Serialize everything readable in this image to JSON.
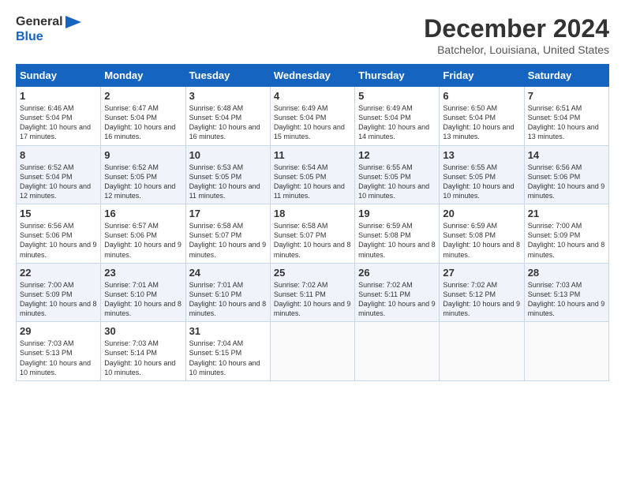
{
  "header": {
    "logo_line1": "General",
    "logo_line2": "Blue",
    "month_title": "December 2024",
    "subtitle": "Batchelor, Louisiana, United States"
  },
  "days_of_week": [
    "Sunday",
    "Monday",
    "Tuesday",
    "Wednesday",
    "Thursday",
    "Friday",
    "Saturday"
  ],
  "weeks": [
    [
      {
        "day": "1",
        "sunrise": "6:46 AM",
        "sunset": "5:04 PM",
        "daylight": "10 hours and 17 minutes."
      },
      {
        "day": "2",
        "sunrise": "6:47 AM",
        "sunset": "5:04 PM",
        "daylight": "10 hours and 16 minutes."
      },
      {
        "day": "3",
        "sunrise": "6:48 AM",
        "sunset": "5:04 PM",
        "daylight": "10 hours and 16 minutes."
      },
      {
        "day": "4",
        "sunrise": "6:49 AM",
        "sunset": "5:04 PM",
        "daylight": "10 hours and 15 minutes."
      },
      {
        "day": "5",
        "sunrise": "6:49 AM",
        "sunset": "5:04 PM",
        "daylight": "10 hours and 14 minutes."
      },
      {
        "day": "6",
        "sunrise": "6:50 AM",
        "sunset": "5:04 PM",
        "daylight": "10 hours and 13 minutes."
      },
      {
        "day": "7",
        "sunrise": "6:51 AM",
        "sunset": "5:04 PM",
        "daylight": "10 hours and 13 minutes."
      }
    ],
    [
      {
        "day": "8",
        "sunrise": "6:52 AM",
        "sunset": "5:04 PM",
        "daylight": "10 hours and 12 minutes."
      },
      {
        "day": "9",
        "sunrise": "6:52 AM",
        "sunset": "5:05 PM",
        "daylight": "10 hours and 12 minutes."
      },
      {
        "day": "10",
        "sunrise": "6:53 AM",
        "sunset": "5:05 PM",
        "daylight": "10 hours and 11 minutes."
      },
      {
        "day": "11",
        "sunrise": "6:54 AM",
        "sunset": "5:05 PM",
        "daylight": "10 hours and 11 minutes."
      },
      {
        "day": "12",
        "sunrise": "6:55 AM",
        "sunset": "5:05 PM",
        "daylight": "10 hours and 10 minutes."
      },
      {
        "day": "13",
        "sunrise": "6:55 AM",
        "sunset": "5:05 PM",
        "daylight": "10 hours and 10 minutes."
      },
      {
        "day": "14",
        "sunrise": "6:56 AM",
        "sunset": "5:06 PM",
        "daylight": "10 hours and 9 minutes."
      }
    ],
    [
      {
        "day": "15",
        "sunrise": "6:56 AM",
        "sunset": "5:06 PM",
        "daylight": "10 hours and 9 minutes."
      },
      {
        "day": "16",
        "sunrise": "6:57 AM",
        "sunset": "5:06 PM",
        "daylight": "10 hours and 9 minutes."
      },
      {
        "day": "17",
        "sunrise": "6:58 AM",
        "sunset": "5:07 PM",
        "daylight": "10 hours and 9 minutes."
      },
      {
        "day": "18",
        "sunrise": "6:58 AM",
        "sunset": "5:07 PM",
        "daylight": "10 hours and 8 minutes."
      },
      {
        "day": "19",
        "sunrise": "6:59 AM",
        "sunset": "5:08 PM",
        "daylight": "10 hours and 8 minutes."
      },
      {
        "day": "20",
        "sunrise": "6:59 AM",
        "sunset": "5:08 PM",
        "daylight": "10 hours and 8 minutes."
      },
      {
        "day": "21",
        "sunrise": "7:00 AM",
        "sunset": "5:09 PM",
        "daylight": "10 hours and 8 minutes."
      }
    ],
    [
      {
        "day": "22",
        "sunrise": "7:00 AM",
        "sunset": "5:09 PM",
        "daylight": "10 hours and 8 minutes."
      },
      {
        "day": "23",
        "sunrise": "7:01 AM",
        "sunset": "5:10 PM",
        "daylight": "10 hours and 8 minutes."
      },
      {
        "day": "24",
        "sunrise": "7:01 AM",
        "sunset": "5:10 PM",
        "daylight": "10 hours and 8 minutes."
      },
      {
        "day": "25",
        "sunrise": "7:02 AM",
        "sunset": "5:11 PM",
        "daylight": "10 hours and 9 minutes."
      },
      {
        "day": "26",
        "sunrise": "7:02 AM",
        "sunset": "5:11 PM",
        "daylight": "10 hours and 9 minutes."
      },
      {
        "day": "27",
        "sunrise": "7:02 AM",
        "sunset": "5:12 PM",
        "daylight": "10 hours and 9 minutes."
      },
      {
        "day": "28",
        "sunrise": "7:03 AM",
        "sunset": "5:13 PM",
        "daylight": "10 hours and 9 minutes."
      }
    ],
    [
      {
        "day": "29",
        "sunrise": "7:03 AM",
        "sunset": "5:13 PM",
        "daylight": "10 hours and 10 minutes."
      },
      {
        "day": "30",
        "sunrise": "7:03 AM",
        "sunset": "5:14 PM",
        "daylight": "10 hours and 10 minutes."
      },
      {
        "day": "31",
        "sunrise": "7:04 AM",
        "sunset": "5:15 PM",
        "daylight": "10 hours and 10 minutes."
      },
      null,
      null,
      null,
      null
    ]
  ]
}
